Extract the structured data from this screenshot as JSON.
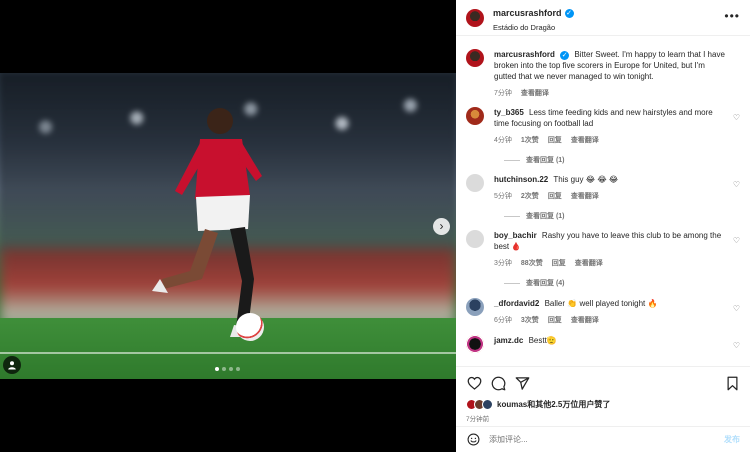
{
  "post": {
    "username": "marcusrashford",
    "location": "Estádio do Dragão",
    "caption": "Bitter Sweet. I'm happy to learn that I have broken into the top five scorers in Europe for United, but I'm gutted that we never managed to win tonight.",
    "caption_time": "7分钟",
    "view_translation": "查看翻译",
    "carousel_slides": 4,
    "carousel_active": 1
  },
  "comments": [
    {
      "user": "ty_b365",
      "text": "Less time feeding kids and new hairstyles and more time focusing on football lad",
      "time": "4分钟",
      "likes": "1次赞",
      "reply": "回复",
      "translate": "查看翻译",
      "replies": "查看回复 (1)"
    },
    {
      "user": "hutchinson.22",
      "text": "This guy 😂 😂 😂",
      "time": "5分钟",
      "likes": "2次赞",
      "reply": "回复",
      "translate": "查看翻译",
      "replies": "查看回复 (1)"
    },
    {
      "user": "boy_bachir",
      "text": "Rashy you have to leave this club to be among the best 🩸",
      "time": "3分钟",
      "likes": "88次赞",
      "reply": "回复",
      "translate": "查看翻译",
      "replies": "查看回复 (4)"
    },
    {
      "user": "_dfordavid2",
      "text": "Baller 👏 well played tonight 🔥",
      "time": "6分钟",
      "likes": "3次赞",
      "reply": "回复",
      "translate": "查看翻译"
    },
    {
      "user": "jamz.dc",
      "text": "Bestt🫡"
    }
  ],
  "likes": {
    "user": "koumas",
    "rest": "和其他2.5万位用户赞了"
  },
  "posted_time": "7分钟前",
  "composer": {
    "placeholder": "添加评论...",
    "post_label": "发布"
  },
  "icons": {
    "like": "heart-icon",
    "comment": "comment-icon",
    "share": "share-icon",
    "save": "bookmark-icon",
    "more": "more-icon",
    "emoji": "emoji-icon",
    "next": "chevron-right-icon",
    "tagged": "user-icon"
  },
  "colors": {
    "verified": "#0095f6",
    "secondary_text": "#737373",
    "post_button_disabled": "#b2dffc"
  }
}
